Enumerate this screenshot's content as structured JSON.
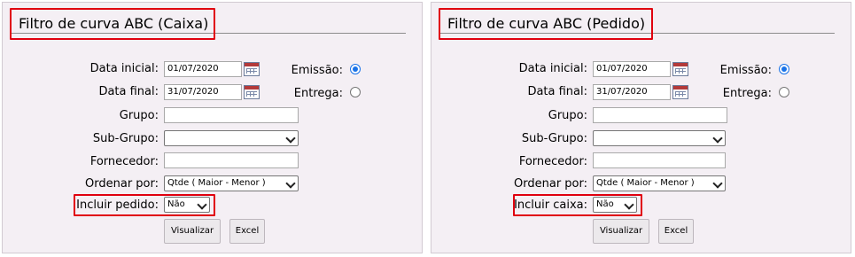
{
  "panels": [
    {
      "title": "Filtro de curva ABC (Caixa)",
      "data_inicial_label": "Data inicial:",
      "data_inicial_value": "01/07/2020",
      "data_final_label": "Data final:",
      "data_final_value": "31/07/2020",
      "emissao_label": "Emissão:",
      "entrega_label": "Entrega:",
      "selected_date_type": "Emissão",
      "grupo_label": "Grupo:",
      "grupo_value": "",
      "subgrupo_label": "Sub-Grupo:",
      "subgrupo_value": "",
      "fornecedor_label": "Fornecedor:",
      "fornecedor_value": "",
      "ordenar_label": "Ordenar por:",
      "ordenar_value": "Qtde ( Maior - Menor )",
      "incluir_label": "Incluir pedido:",
      "incluir_value": "Não",
      "visualizar_label": "Visualizar",
      "excel_label": "Excel"
    },
    {
      "title": "Filtro de curva ABC (Pedido)",
      "data_inicial_label": "Data inicial:",
      "data_inicial_value": "01/07/2020",
      "data_final_label": "Data final:",
      "data_final_value": "31/07/2020",
      "emissao_label": "Emissão:",
      "entrega_label": "Entrega:",
      "selected_date_type": "Emissão",
      "grupo_label": "Grupo:",
      "grupo_value": "",
      "subgrupo_label": "Sub-Grupo:",
      "subgrupo_value": "",
      "fornecedor_label": "Fornecedor:",
      "fornecedor_value": "",
      "ordenar_label": "Ordenar por:",
      "ordenar_value": "Qtde ( Maior - Menor )",
      "incluir_label": "Incluir caixa:",
      "incluir_value": "Não",
      "visualizar_label": "Visualizar",
      "excel_label": "Excel"
    }
  ],
  "colors": {
    "highlight": "#e0000f",
    "panel_bg": "#f4eff4",
    "radio_selected": "#1a73e8"
  }
}
